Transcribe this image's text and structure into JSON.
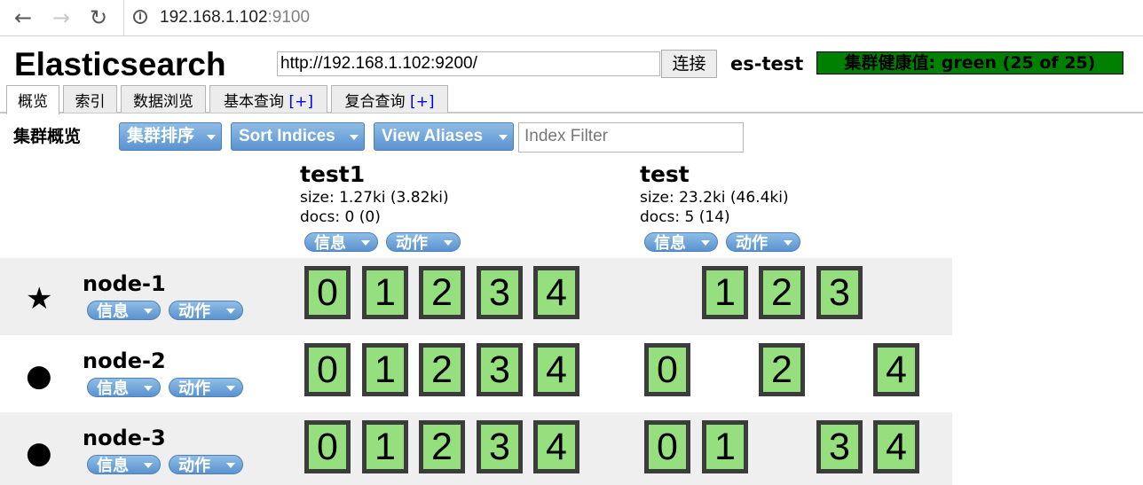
{
  "browser": {
    "back_icon": "arrow-left-icon",
    "forward_icon": "arrow-right-icon",
    "reload_icon": "reload-icon",
    "url_host": "192.168.1.102",
    "url_port": ":9100"
  },
  "app": {
    "title": "Elasticsearch",
    "connect_url": "http://192.168.1.102:9200/",
    "connect_label": "连接",
    "cluster_name": "es-test",
    "health_text": "集群健康值: green (25 of 25)",
    "health_color": "#008000"
  },
  "tabs": [
    {
      "label": "概览",
      "plus": ""
    },
    {
      "label": "索引",
      "plus": ""
    },
    {
      "label": "数据浏览",
      "plus": ""
    },
    {
      "label": "基本查询",
      "plus": "[+]"
    },
    {
      "label": "复合查询",
      "plus": "[+]"
    }
  ],
  "toolbar": {
    "title": "集群概览",
    "sort_cluster": "集群排序",
    "sort_indices": "Sort Indices",
    "view_aliases": "View Aliases",
    "filter_placeholder": "Index Filter"
  },
  "indices": [
    {
      "name": "test1",
      "size": "size: 1.27ki (3.82ki)",
      "docs": "docs: 0 (0)",
      "info_label": "信息",
      "action_label": "动作"
    },
    {
      "name": "test",
      "size": "size: 23.2ki (46.4ki)",
      "docs": "docs: 5 (14)",
      "info_label": "信息",
      "action_label": "动作"
    }
  ],
  "nodes": [
    {
      "name": "node-1",
      "icon": "star-icon",
      "glyph": "★",
      "info_label": "信息",
      "action_label": "动作",
      "shards_test1": [
        "0",
        "1",
        "2",
        "3",
        "4"
      ],
      "shards_test": [
        "1",
        "2",
        "3"
      ]
    },
    {
      "name": "node-2",
      "icon": "circle-icon",
      "glyph": "●",
      "info_label": "信息",
      "action_label": "动作",
      "shards_test1": [
        "0",
        "1",
        "2",
        "3",
        "4"
      ],
      "shards_test": [
        "0",
        "2",
        "4"
      ]
    },
    {
      "name": "node-3",
      "icon": "circle-icon",
      "glyph": "●",
      "info_label": "信息",
      "action_label": "动作",
      "shards_test1": [
        "0",
        "1",
        "2",
        "3",
        "4"
      ],
      "shards_test": [
        "0",
        "1",
        "3",
        "4"
      ]
    }
  ],
  "colors": {
    "shard_fill": "#96df7e",
    "button_blue": "#5a93cf"
  }
}
